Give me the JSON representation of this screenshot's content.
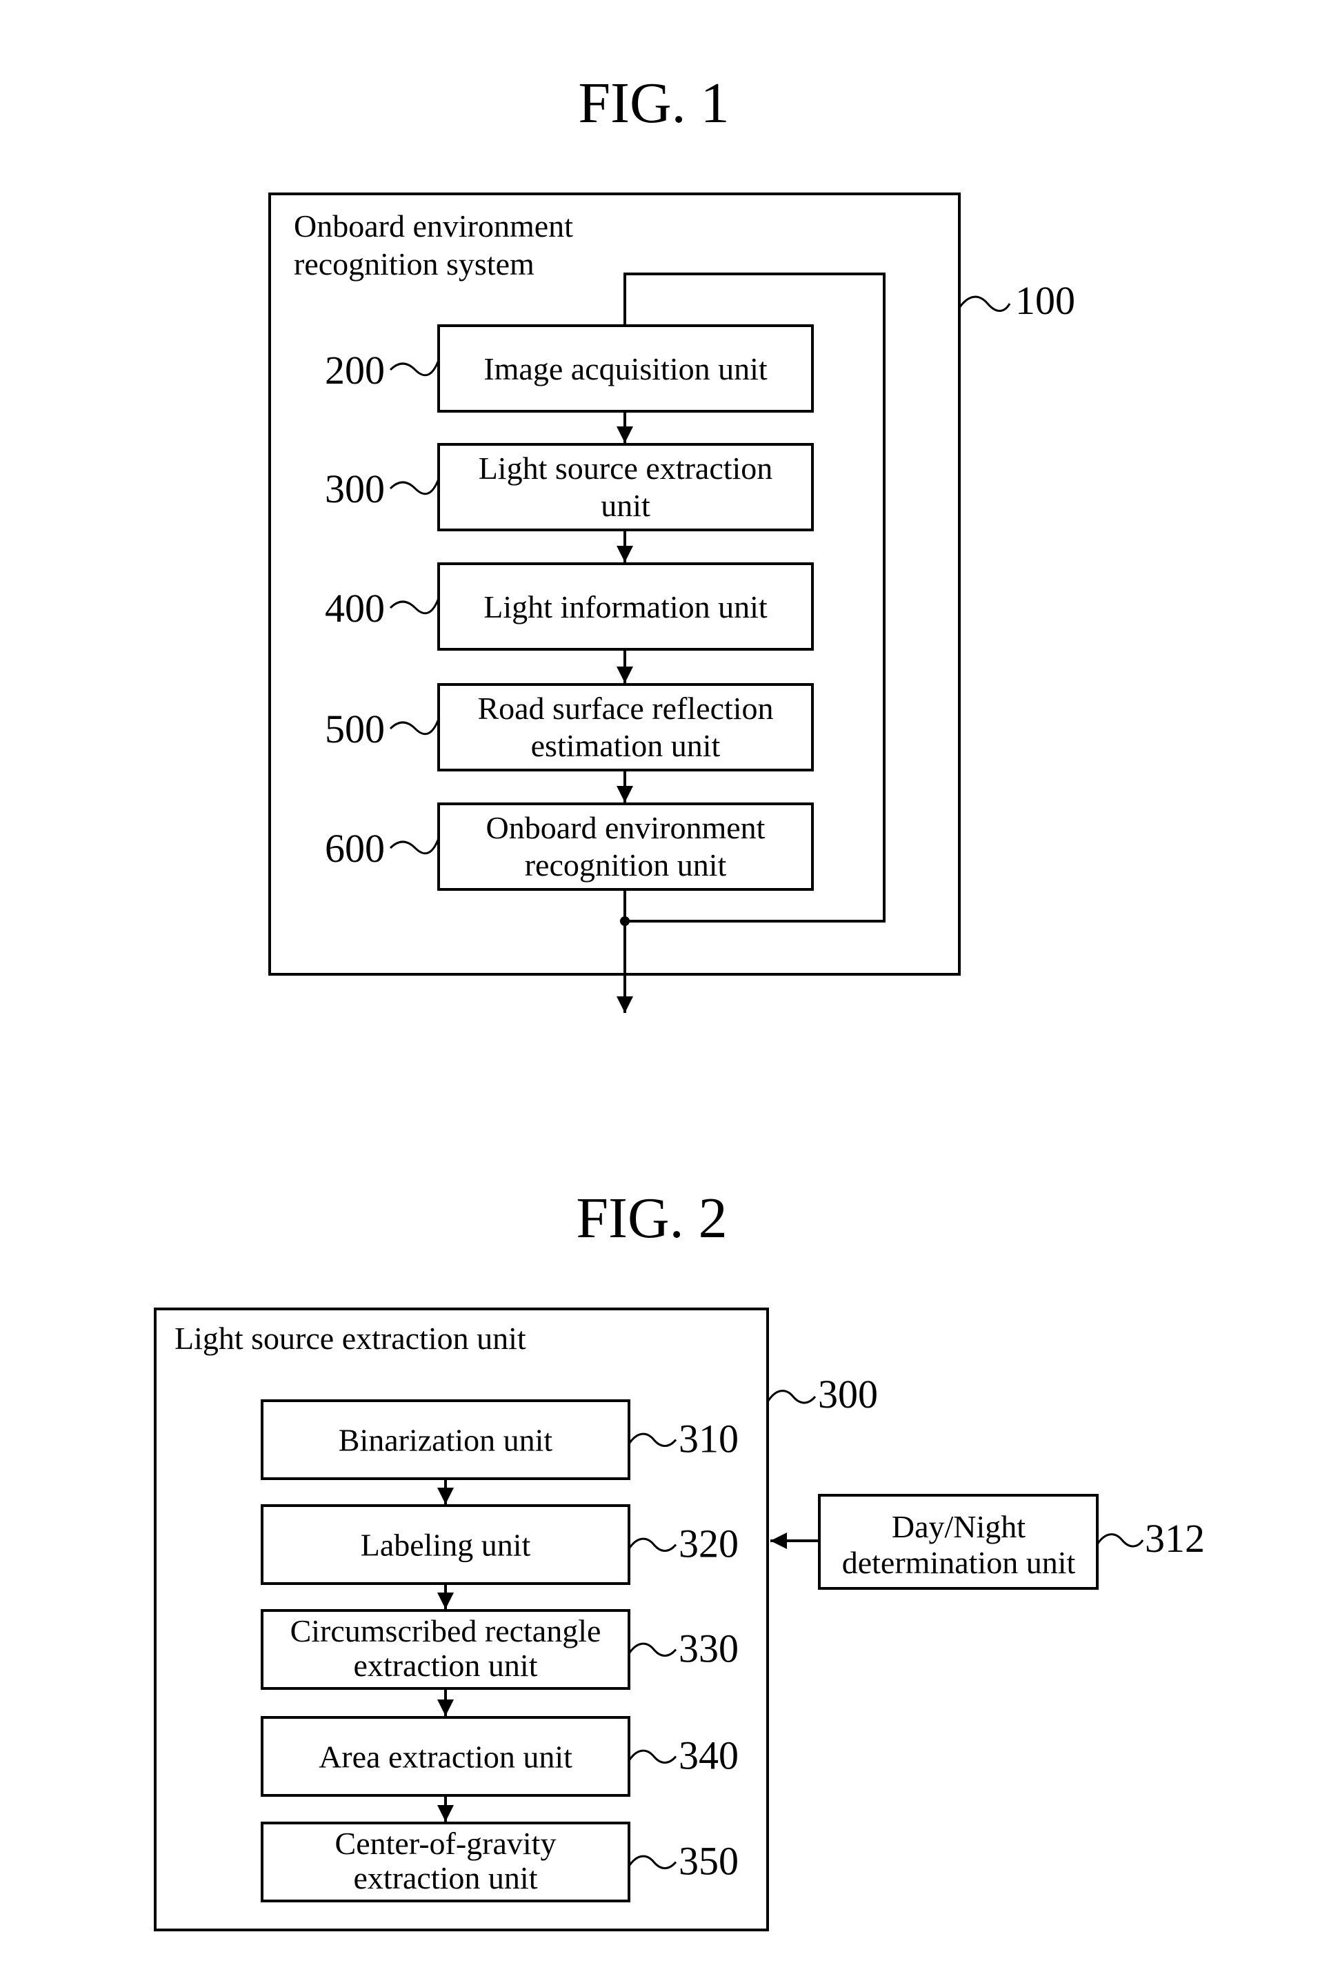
{
  "fig1": {
    "title": "FIG. 1",
    "system": {
      "ref": "100",
      "title_lines": [
        "Onboard environment",
        "recognition system"
      ]
    },
    "units": [
      {
        "ref": "200",
        "lines": [
          "Image acquisition unit"
        ]
      },
      {
        "ref": "300",
        "lines": [
          "Light source extraction",
          "unit"
        ]
      },
      {
        "ref": "400",
        "lines": [
          "Light information unit"
        ]
      },
      {
        "ref": "500",
        "lines": [
          "Road surface reflection",
          "estimation unit"
        ]
      },
      {
        "ref": "600",
        "lines": [
          "Onboard environment",
          "recognition unit"
        ]
      }
    ]
  },
  "fig2": {
    "title": "FIG. 2",
    "container": {
      "ref": "300",
      "title": "Light source extraction unit"
    },
    "units": [
      {
        "ref": "310",
        "lines": [
          "Binarization unit"
        ]
      },
      {
        "ref": "320",
        "lines": [
          "Labeling unit"
        ]
      },
      {
        "ref": "330",
        "lines": [
          "Circumscribed rectangle",
          "extraction unit"
        ]
      },
      {
        "ref": "340",
        "lines": [
          "Area extraction unit"
        ]
      },
      {
        "ref": "350",
        "lines": [
          "Center-of-gravity",
          "extraction unit"
        ]
      }
    ],
    "external": {
      "ref": "312",
      "lines": [
        "Day/Night",
        "determination unit"
      ]
    }
  }
}
